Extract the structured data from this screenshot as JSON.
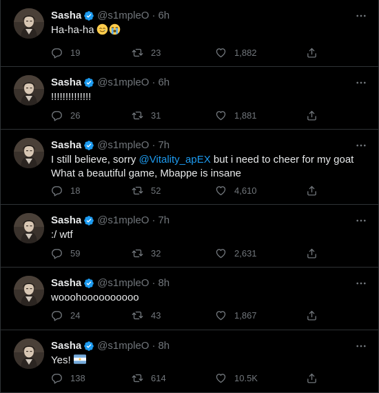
{
  "tweets": [
    {
      "name": "Sasha",
      "handle": "@s1mpleO",
      "dot": "·",
      "time": "6h",
      "text": "Ha-ha-ha",
      "emojis": [
        "smiling-face-with-tear-emoji",
        "crying-face-emoji"
      ],
      "replies": "19",
      "retweets": "23",
      "likes": "1,882"
    },
    {
      "name": "Sasha",
      "handle": "@s1mpleO",
      "dot": "·",
      "time": "6h",
      "text": "!!!!!!!!!!!!!!",
      "replies": "26",
      "retweets": "31",
      "likes": "1,881"
    },
    {
      "name": "Sasha",
      "handle": "@s1mpleO",
      "dot": "·",
      "time": "7h",
      "text_before": "I still believe, sorry ",
      "mention": "@Vitality_apEX",
      "text_after": " but i need to cheer for my goat",
      "text_line2": "What a beautiful game, Mbappe is insane",
      "replies": "18",
      "retweets": "52",
      "likes": "4,610"
    },
    {
      "name": "Sasha",
      "handle": "@s1mpleO",
      "dot": "·",
      "time": "7h",
      "text": ":/ wtf",
      "replies": "59",
      "retweets": "32",
      "likes": "2,631"
    },
    {
      "name": "Sasha",
      "handle": "@s1mpleO",
      "dot": "·",
      "time": "8h",
      "text": "wooohoooooooooo",
      "replies": "24",
      "retweets": "43",
      "likes": "1,867"
    },
    {
      "name": "Sasha",
      "handle": "@s1mpleO",
      "dot": "·",
      "time": "8h",
      "text": "Yes!",
      "emojis": [
        "argentina-flag-emoji"
      ],
      "replies": "138",
      "retweets": "614",
      "likes": "10.5K"
    }
  ],
  "colors": {
    "background": "#000000",
    "text": "#e7e9ea",
    "muted": "#71767b",
    "accent": "#1d9bf0",
    "divider": "#2f3336"
  }
}
